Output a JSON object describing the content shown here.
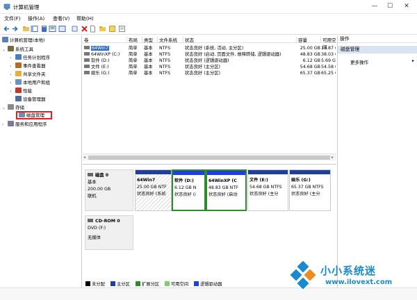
{
  "window": {
    "title": "计算机管理",
    "controls": [
      "—",
      "☐",
      "✕"
    ]
  },
  "menu": [
    "文件(F)",
    "操作(A)",
    "查看(V)",
    "帮助(H)"
  ],
  "tree": [
    {
      "label": "计算机管理(本地)",
      "arrow": "",
      "color": "#5b7fb8"
    },
    {
      "label": "系统工具",
      "arrow": "⌄",
      "color": "#7a6a3a"
    },
    {
      "label": "任务计划程序",
      "arrow": "›",
      "color": "#4a7fbf"
    },
    {
      "label": "事件查看器",
      "arrow": "›",
      "color": "#b36b2c"
    },
    {
      "label": "共享文件夹",
      "arrow": "›",
      "color": "#e2b23a"
    },
    {
      "label": "本地用户和组",
      "arrow": "›",
      "color": "#6c8fc7"
    },
    {
      "label": "性能",
      "arrow": "›",
      "color": "#c0392b"
    },
    {
      "label": "设备管理器",
      "arrow": "",
      "color": "#4e6e9e"
    },
    {
      "label": "存储",
      "arrow": "⌄",
      "color": "#8a8a8a"
    },
    {
      "label": "磁盘管理",
      "arrow": "",
      "color": "#6b8fb5"
    },
    {
      "label": "服务和应用程序",
      "arrow": "›",
      "color": "#7a7a9a"
    }
  ],
  "volumes": {
    "headers": [
      "卷",
      "布局",
      "类型",
      "文件系统",
      "状态",
      "容量",
      "可用空间"
    ],
    "rows": [
      {
        "vol": "64Win7",
        "layout": "",
        "type": "",
        "fs": "",
        "status": "",
        "cap": "",
        "free": "",
        "selected": true
      },
      {
        "vol": "64WinXP (C:)",
        "layout": "简单",
        "type": "基本",
        "fs": "NTFS",
        "status": "状态良好 (启动, 页面文件, 故障转储, 逻辑驱动器)",
        "cap": "48.83 GB",
        "free": "38.03 GB",
        "selected": false
      },
      {
        "vol": "软件 (D:)",
        "layout": "简单",
        "type": "基本",
        "fs": "NTFS",
        "status": "状态良好 (逻辑驱动器)",
        "cap": "6.12 GB",
        "free": "5.69 GB",
        "selected": false
      },
      {
        "vol": "文件 (E:)",
        "layout": "简单",
        "type": "基本",
        "fs": "NTFS",
        "status": "状态良好 (主分区)",
        "cap": "54.68 GB",
        "free": "54.58 GB",
        "selected": false
      },
      {
        "vol": "娱乐 (G:)",
        "layout": "简单",
        "type": "基本",
        "fs": "NTFS",
        "status": "状态良好 (主分区)",
        "cap": "65.37 GB",
        "free": "65.25 GB",
        "selected": false
      }
    ],
    "row0_overlay": {
      "layout": "简单",
      "type": "基本",
      "fs": "NTFS",
      "status": "状态良好 (系统, 活动, 主分区)",
      "cap": "25.00 GB",
      "free": "13.87 GB"
    }
  },
  "disk0": {
    "name": "磁盘 0",
    "type": "基本",
    "size": "200.00 GB",
    "state": "联机",
    "partitions": [
      {
        "name": "64Win7",
        "size": "25.00 GB NTF",
        "status": "状态良好 (系统",
        "band": "#1f3fa0",
        "selected": false,
        "hatch": true
      },
      {
        "name": "软件 (D:)",
        "size": "6.12 GB N",
        "status": "状态良好 (i",
        "band": "#1f3fe0",
        "selected": true,
        "hatch": false
      },
      {
        "name": "64WinXP (C",
        "size": "48.83 GB NTF",
        "status": "状态良好 (启动",
        "band": "#1f3fe0",
        "selected": true,
        "hatch": false
      },
      {
        "name": "文件 (E:)",
        "size": "54.68 GB NTFS",
        "status": "状态良好 (主分",
        "band": "#1f3fa0",
        "selected": false,
        "hatch": false
      },
      {
        "name": "娱乐 (G:)",
        "size": "65.37 GB NTFS",
        "status": "状态良好 (主分",
        "band": "#1f3fa0",
        "selected": false,
        "hatch": false
      }
    ]
  },
  "cdrom": {
    "name": "CD-ROM 0",
    "drive": "DVD (F:)",
    "media": "无媒体"
  },
  "legend": [
    {
      "label": "未分配",
      "color": "#000000"
    },
    {
      "label": "主分区",
      "color": "#1f3fa0"
    },
    {
      "label": "扩展分区",
      "color": "#2f8a2f"
    },
    {
      "label": "可用空间",
      "color": "#7fd06a"
    },
    {
      "label": "逻辑驱动器",
      "color": "#1f3fe0"
    }
  ],
  "actions": {
    "header": "操作",
    "title": "磁盘管理",
    "more": "更多操作",
    "more_arrow": "▸"
  },
  "watermark": {
    "text": "小小系统迷",
    "url": "www.ilovext.com"
  }
}
